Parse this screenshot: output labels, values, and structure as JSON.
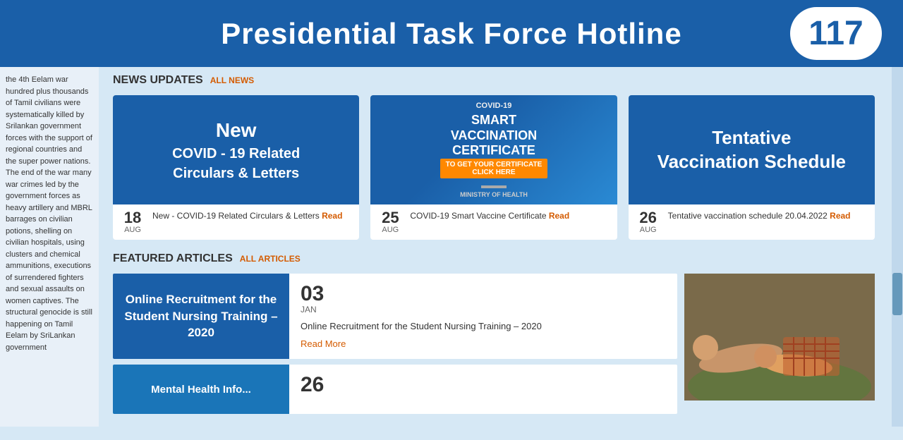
{
  "header": {
    "title": "Presidential Task Force  Hotline",
    "number": "117"
  },
  "sidebar": {
    "text": "the 4th Eelam war hundred plus thousands of Tamil civilians were systematically killed by Srilankan government forces with the support of regional countries and the super power nations. The end of the war many war crimes led by the government forces as heavy artillery and MBRL barrages on civilian potions, shelling on civilian hospitals, using clusters and chemical ammunitions, executions of surrendered fighters and sexual assaults on women captives. The structural genocide is still happening on Tamil Eelam by SriLankan government"
  },
  "news_section": {
    "title": "NEWS UPDATES",
    "link_label": "ALL NEWS",
    "cards": [
      {
        "banner_line1": "New",
        "banner_line2": "COVID - 19 Related Circulars & Letters",
        "date_num": "18",
        "date_month": "AUG",
        "desc": "New - COVID-19 Related Circulars & Letters",
        "read_label": "Read"
      },
      {
        "banner_top": "COVID-19",
        "banner_mid": "SMART VACCINATION CERTIFICATE",
        "banner_cta": "TO GET YOUR CERTIFICATE CLICK HERE",
        "date_num": "25",
        "date_month": "AUG",
        "desc": "COVID-19 Smart Vaccine Certificate",
        "read_label": "Read"
      },
      {
        "banner_line1": "Tentative",
        "banner_line2": "Vaccination Schedule",
        "date_num": "26",
        "date_month": "AUG",
        "desc": "Tentative vaccination schedule 20.04.2022",
        "read_label": "Read"
      }
    ]
  },
  "featured_section": {
    "title": "FEATURED ARTICLES",
    "link_label": "ALL ARTICLES",
    "articles": [
      {
        "banner_text": "Online Recruitment for the Student Nursing Training – 2020",
        "date_num": "03",
        "date_month": "JAN",
        "desc": "Online Recruitment for the Student Nursing Training – 2020",
        "read_more": "Read More"
      },
      {
        "banner_text": "Mental Health Info...",
        "date_num": "26",
        "date_month": "",
        "desc": "",
        "read_more": ""
      }
    ]
  }
}
